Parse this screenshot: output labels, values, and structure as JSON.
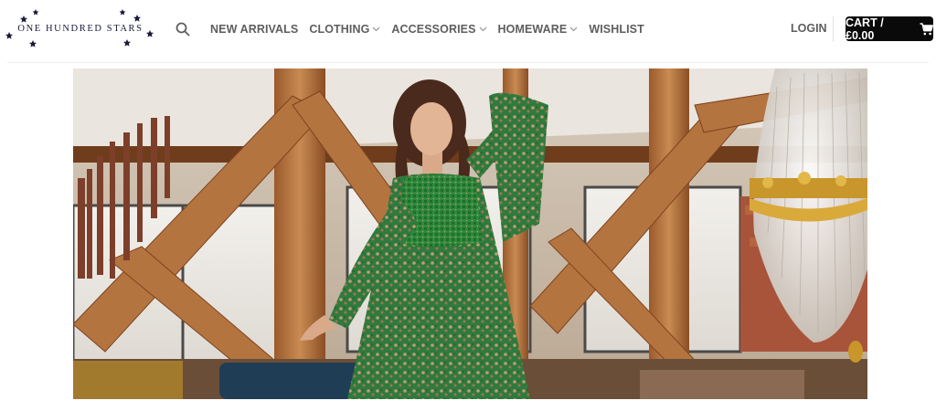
{
  "brand": {
    "logo_text": "ONE HUNDRED STARS"
  },
  "nav": {
    "items": [
      {
        "label": "NEW ARRIVALS",
        "has_dropdown": false
      },
      {
        "label": "CLOTHING",
        "has_dropdown": true
      },
      {
        "label": "ACCESSORIES",
        "has_dropdown": true
      },
      {
        "label": "HOMEWARE",
        "has_dropdown": true
      },
      {
        "label": "WISHLIST",
        "has_dropdown": false
      }
    ]
  },
  "account": {
    "login_label": "LOGIN"
  },
  "cart": {
    "label": "CART / £0.00",
    "icon": "cart-icon"
  },
  "colors": {
    "cart_bg": "#0a0a0a",
    "nav_text": "#5e5e5e",
    "logo_navy": "#1a1a3a"
  },
  "hero": {
    "image": "woman in green floral maxi dress in a loft with wooden beams and crystal chandelier"
  }
}
